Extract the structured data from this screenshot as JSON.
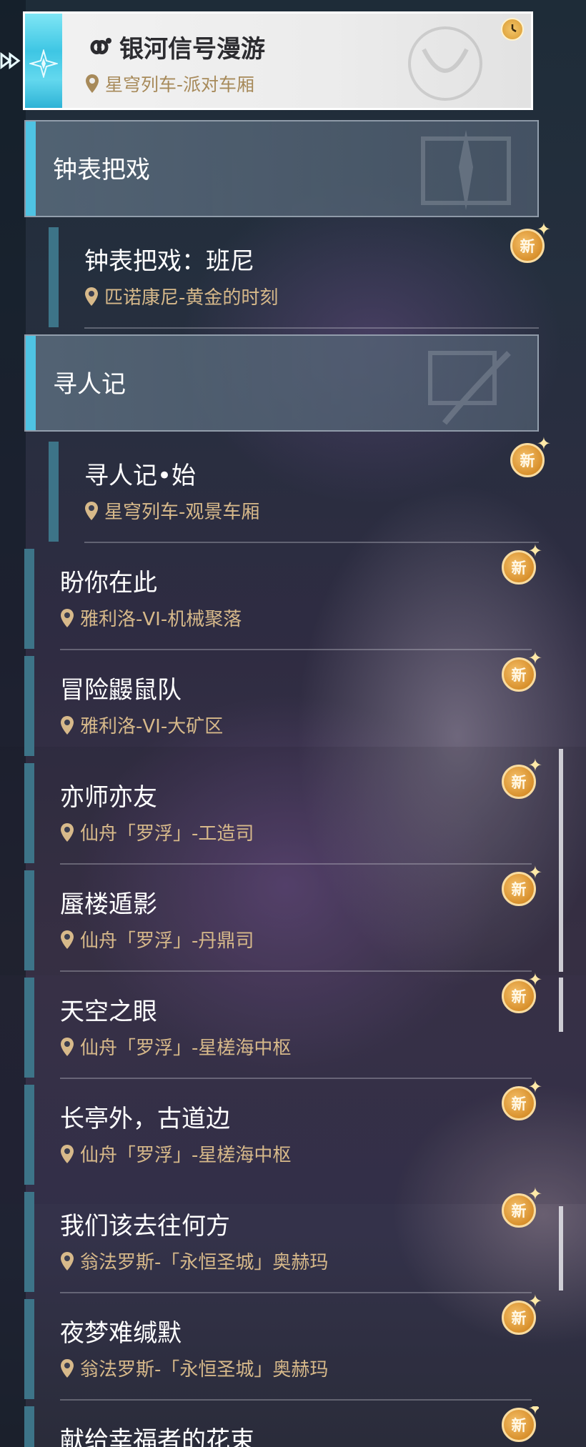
{
  "top_card": {
    "title": "银河信号漫游",
    "location": "星穹列车-派对车厢",
    "icon": "infinity-link-icon",
    "badge_icon": "clock-icon"
  },
  "categories": [
    {
      "label": "钟表把戏"
    },
    {
      "label": "寻人记"
    }
  ],
  "quests": [
    {
      "title": "钟表把戏：班尼",
      "location": "匹诺康尼-黄金的时刻",
      "badge": "新"
    },
    {
      "title": "寻人记•始",
      "location": "星穹列车-观景车厢",
      "badge": "新"
    },
    {
      "title": "盼你在此",
      "location": "雅利洛-VI-机械聚落",
      "badge": "新"
    },
    {
      "title": "冒险鼹鼠队",
      "location": "雅利洛-VI-大矿区",
      "badge": "新"
    },
    {
      "title": "亦师亦友",
      "location": "仙舟「罗浮」-工造司",
      "badge": "新"
    },
    {
      "title": "蜃楼遁影",
      "location": "仙舟「罗浮」-丹鼎司",
      "badge": "新"
    },
    {
      "title": "天空之眼",
      "location": "仙舟「罗浮」-星槎海中枢",
      "badge": "新"
    },
    {
      "title": "长亭外，古道边",
      "location": "仙舟「罗浮」-星槎海中枢",
      "badge": "新"
    },
    {
      "title": "我们该去往何方",
      "location": "翁法罗斯-「永恒圣城」奥赫玛",
      "badge": "新"
    },
    {
      "title": "夜梦难缄默",
      "location": "翁法罗斯-「永恒圣城」奥赫玛",
      "badge": "新"
    },
    {
      "title": "献给幸福者的花束",
      "location": "",
      "badge": "新"
    }
  ],
  "colors": {
    "accent": "#4fc3e3",
    "location_gold": "#d7b98a",
    "badge_orange": "#d8902c"
  }
}
